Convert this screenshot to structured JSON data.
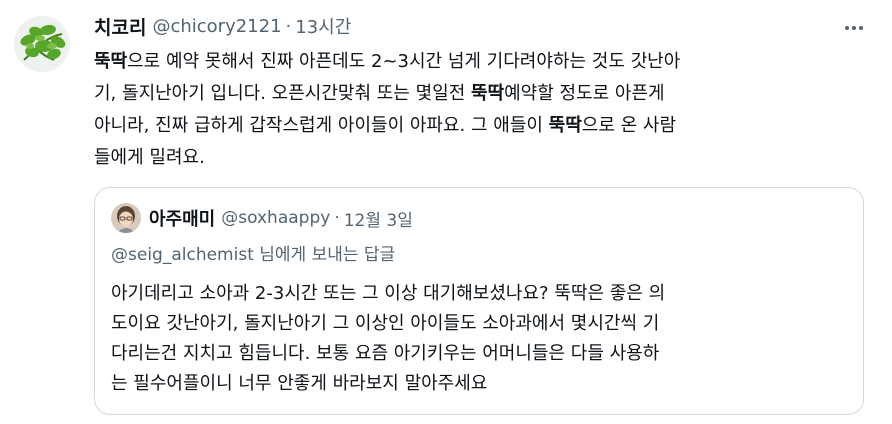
{
  "tweet": {
    "display_name": "치코리",
    "handle": "@chicory2121",
    "separator": "·",
    "time": "13시간",
    "lines": [
      [
        {
          "t": "뚝딱",
          "b": true
        },
        {
          "t": "으로 예약 못해서 진짜 아픈데도 2~3시간 넘게 기다려야하는 것도 갓난아"
        }
      ],
      [
        {
          "t": "기, 돌지난아기 입니다.  오픈시간맞춰 또는 몇일전 "
        },
        {
          "t": "뚝딱",
          "b": true
        },
        {
          "t": "예약할 정도로 아픈게"
        }
      ],
      [
        {
          "t": "아니라, 진짜 급하게 갑작스럽게 아이들이 아파요. 그 애들이 "
        },
        {
          "t": "뚝딱",
          "b": true
        },
        {
          "t": "으로 온 사람"
        }
      ],
      [
        {
          "t": "들에게 밀려요."
        }
      ]
    ]
  },
  "quote": {
    "display_name": "아주매미",
    "handle": "@soxhaappy",
    "separator": "·",
    "time": "12월 3일",
    "reply_to": "@seig_alchemist 님에게 보내는 답글",
    "lines": [
      "아기데리고 소아과 2-3시간 또는 그 이상 대기해보셨나요? 뚝딱은 좋은 의",
      "도이요 갓난아기, 돌지난아기 그 이상인 아이들도 소아과에서 몇시간씩 기",
      "다리는건 지치고 힘듭니다. 보통 요즘 아기키우는 어머니들은 다들 사용하",
      "는 필수어플이니 너무 안좋게 바라보지 말아주세요"
    ]
  },
  "icons": {
    "avatar": "parsley-photo-avatar",
    "quote_avatar": "person-photo-avatar",
    "more": "more-icon"
  },
  "colors": {
    "text_primary": "#0f1419",
    "text_secondary": "#536471",
    "border": "#cfd9de"
  }
}
